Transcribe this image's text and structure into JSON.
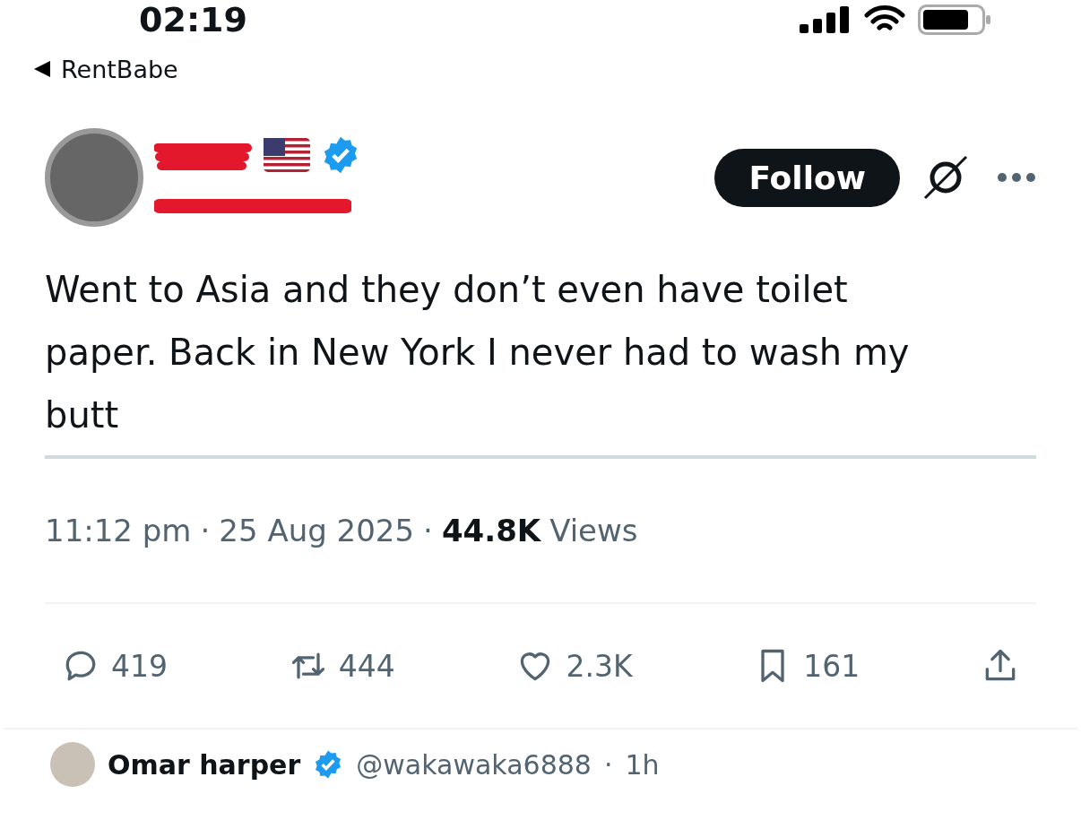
{
  "status_bar": {
    "time": "02:19"
  },
  "back": {
    "label": "RentBabe"
  },
  "author": {
    "verified": true,
    "follow_label": "Follow"
  },
  "tweet": {
    "text": "Went to Asia and they don’t even have toilet paper. Back in New York I never had to wash my butt"
  },
  "meta": {
    "time": "11:12 pm",
    "separator_1": "·",
    "date": "25 Aug 2025",
    "separator_2": "·",
    "views_count": "44.8K",
    "views_label": "Views"
  },
  "actions": [
    {
      "kind": "reply",
      "count": "419"
    },
    {
      "kind": "repost",
      "count": "444"
    },
    {
      "kind": "like",
      "count": "2.3K"
    },
    {
      "kind": "bookmark",
      "count": "161"
    },
    {
      "kind": "share"
    }
  ],
  "reply": {
    "name": "Omar harper",
    "verified": true,
    "handle": "@wakawaka6888",
    "separator": "·",
    "time": "1h"
  }
}
